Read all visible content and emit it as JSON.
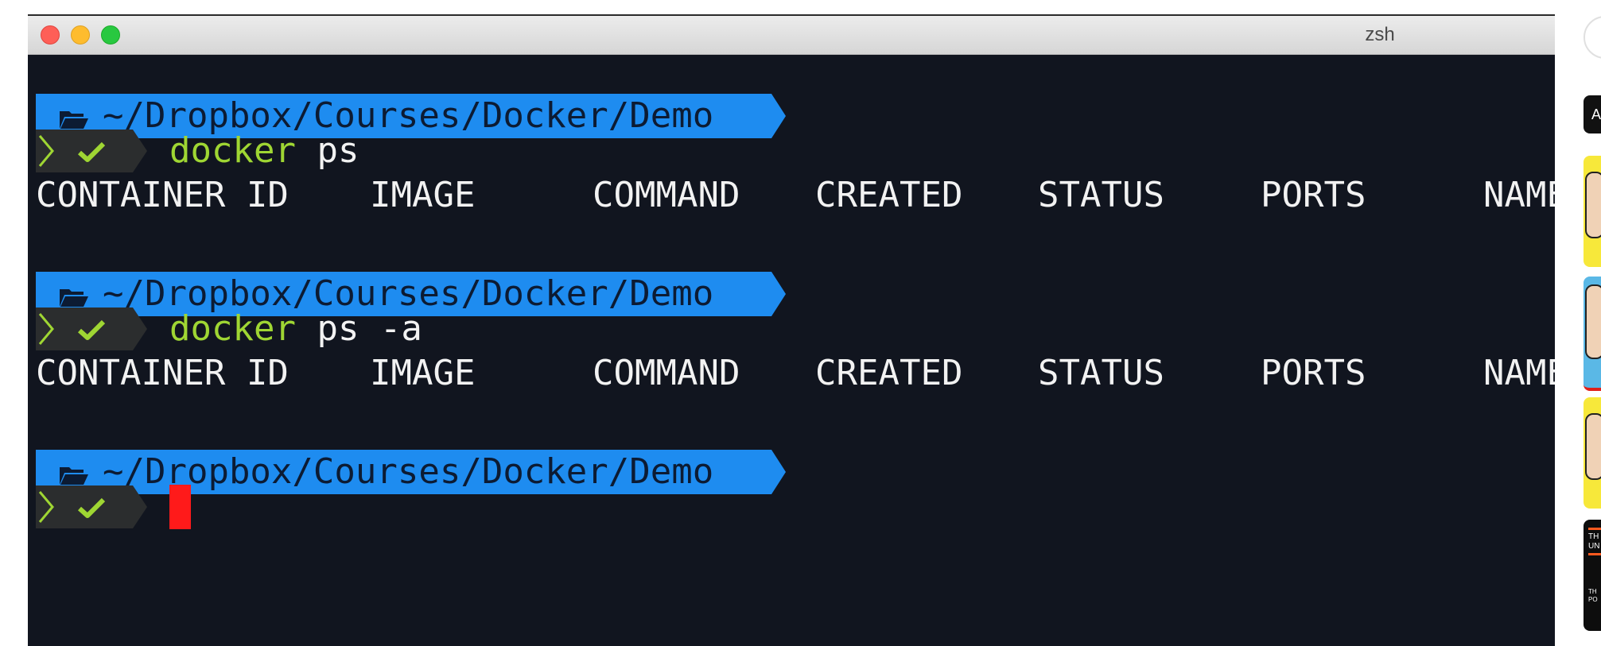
{
  "window": {
    "title": "zsh"
  },
  "prompt": {
    "path": "~/Dropbox/Courses/Docker/Demo"
  },
  "commands": [
    {
      "name": "docker",
      "args": "ps"
    },
    {
      "name": "docker",
      "args": "ps -a"
    }
  ],
  "table_headers": [
    "CONTAINER ID",
    "IMAGE",
    "COMMAND",
    "CREATED",
    "STATUS",
    "PORTS",
    "NAME"
  ],
  "sidebar": {
    "top_label": "A",
    "thumb4_lines": [
      "TH",
      "UN"
    ],
    "thumb4_bottom": [
      "TH",
      "PO"
    ]
  },
  "colors": {
    "terminal_bg": "#11151f",
    "path_segment": "#1e8cf0",
    "command_name": "#9fd633",
    "checkmark": "#9fd633",
    "cursor": "#ff1a1a"
  },
  "icons": {
    "folder": "folder-open-icon",
    "status": "checkmark-icon",
    "prompt": "chevron-right-icon"
  }
}
